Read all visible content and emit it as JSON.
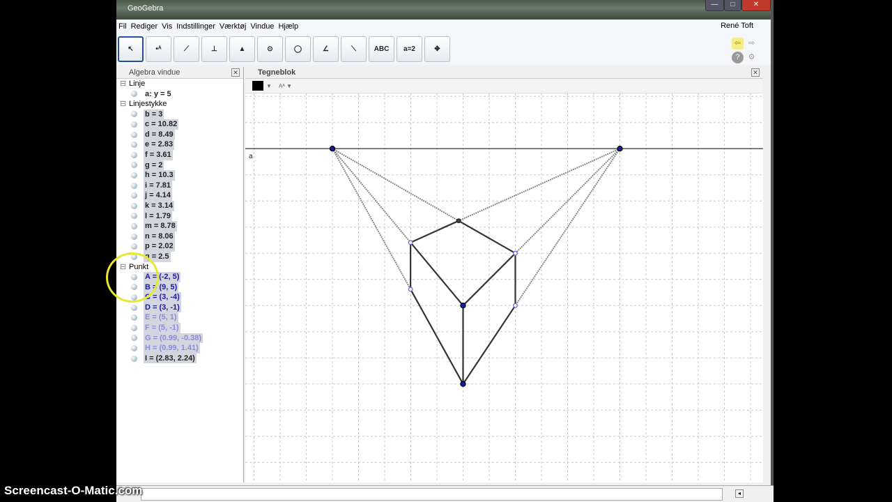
{
  "window": {
    "title": "GeoGebra"
  },
  "menu": [
    "Fil",
    "Rediger",
    "Vis",
    "Indstillinger",
    "Værktøj",
    "Vindue",
    "Hjælp"
  ],
  "user": "René Toft",
  "tools": [
    {
      "name": "move-tool",
      "label": "↖"
    },
    {
      "name": "point-tool",
      "label": "•ᴬ"
    },
    {
      "name": "segment-tool",
      "label": "⟋"
    },
    {
      "name": "perpendicular-tool",
      "label": "⊥"
    },
    {
      "name": "polygon-tool",
      "label": "▲"
    },
    {
      "name": "circle-tool",
      "label": "⊙"
    },
    {
      "name": "conic-tool",
      "label": "◯"
    },
    {
      "name": "angle-tool",
      "label": "∠"
    },
    {
      "name": "reflect-tool",
      "label": "⟍"
    },
    {
      "name": "text-tool",
      "label": "ABC"
    },
    {
      "name": "slider-tool",
      "label": "a=2"
    },
    {
      "name": "move-view-tool",
      "label": "✥"
    }
  ],
  "algebra": {
    "title": "Algebra vindue",
    "groups": [
      {
        "label": "Linje",
        "items": [
          {
            "text": "a: y = 5",
            "style": "plain"
          }
        ]
      },
      {
        "label": "Linjestykke",
        "items": [
          {
            "text": "b = 3",
            "style": "plain"
          },
          {
            "text": "c = 10.82",
            "style": "plain"
          },
          {
            "text": "d = 8.49",
            "style": "plain"
          },
          {
            "text": "e = 2.83",
            "style": "plain"
          },
          {
            "text": "f = 3.61",
            "style": "plain"
          },
          {
            "text": "g = 2",
            "style": "plain"
          },
          {
            "text": "h = 10.3",
            "style": "plain"
          },
          {
            "text": "i = 7.81",
            "style": "plain"
          },
          {
            "text": "j = 4.14",
            "style": "plain"
          },
          {
            "text": "k = 3.14",
            "style": "plain"
          },
          {
            "text": "l = 1.79",
            "style": "plain"
          },
          {
            "text": "m = 8.78",
            "style": "plain"
          },
          {
            "text": "n = 8.06",
            "style": "plain"
          },
          {
            "text": "p = 2.02",
            "style": "plain"
          },
          {
            "text": "q = 2.5",
            "style": "plain"
          }
        ]
      },
      {
        "label": "Punkt",
        "items": [
          {
            "text": "A = (-2, 5)",
            "style": "dark"
          },
          {
            "text": "B = (9, 5)",
            "style": "dark"
          },
          {
            "text": "C = (3, -4)",
            "style": "dark"
          },
          {
            "text": "D = (3, -1)",
            "style": "dark"
          },
          {
            "text": "E = (5, 1)",
            "style": "light"
          },
          {
            "text": "F = (5, -1)",
            "style": "light"
          },
          {
            "text": "G = (0.99, -0.38)",
            "style": "light"
          },
          {
            "text": "H = (0.99, 1.41)",
            "style": "light"
          },
          {
            "text": "I = (2.83, 2.24)",
            "style": "plain"
          }
        ]
      }
    ]
  },
  "graphics": {
    "title": "Tegneblok",
    "line_label": "a",
    "points": {
      "A": [
        -2,
        5
      ],
      "B": [
        9,
        5
      ],
      "C": [
        3,
        -4
      ],
      "D": [
        3,
        -1
      ],
      "E": [
        5,
        1
      ],
      "F": [
        5,
        -1
      ],
      "G": [
        0.99,
        -0.38
      ],
      "H": [
        0.99,
        1.41
      ],
      "I": [
        2.83,
        2.24
      ]
    },
    "solid": [
      [
        "H",
        "I"
      ],
      [
        "I",
        "E"
      ],
      [
        "H",
        "G"
      ],
      [
        "H",
        "D"
      ],
      [
        "E",
        "D"
      ],
      [
        "E",
        "F"
      ],
      [
        "G",
        "C"
      ],
      [
        "F",
        "C"
      ],
      [
        "D",
        "C"
      ]
    ],
    "dotted": [
      [
        "A",
        "H"
      ],
      [
        "A",
        "G"
      ],
      [
        "A",
        "I"
      ],
      [
        "B",
        "I"
      ],
      [
        "B",
        "E"
      ],
      [
        "B",
        "F"
      ]
    ],
    "colors": {
      "dark": "#1a1aa8",
      "light": "#6a6ad8",
      "line": "#333333"
    }
  },
  "watermark": "Screencast-O-Matic.com"
}
